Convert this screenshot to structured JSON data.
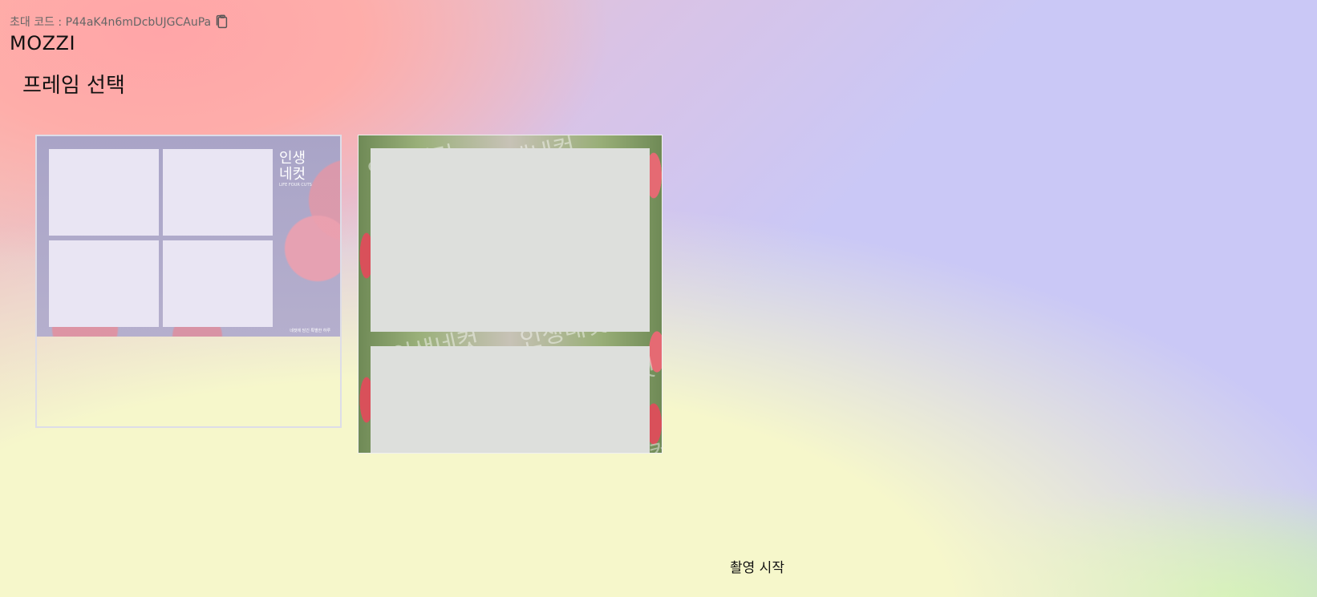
{
  "header": {
    "invite_label": "초대 코드 : P44aK4n6mDcbUJGCAuPa",
    "copy_icon": "clipboard-copy-icon",
    "brand": "MOZZI"
  },
  "page": {
    "title": "프레임 선택"
  },
  "frames": [
    {
      "name": "cherry-blossom-frame",
      "brand_line1": "인생",
      "brand_line2": "네컷",
      "brand_sub": "LIFE FOUR CUTS",
      "footer": "네컷에 담긴 특별한 하루"
    },
    {
      "name": "tulip-frame",
      "watermark": "인생네컷"
    }
  ],
  "actions": {
    "start_label": "촬영 시작"
  }
}
